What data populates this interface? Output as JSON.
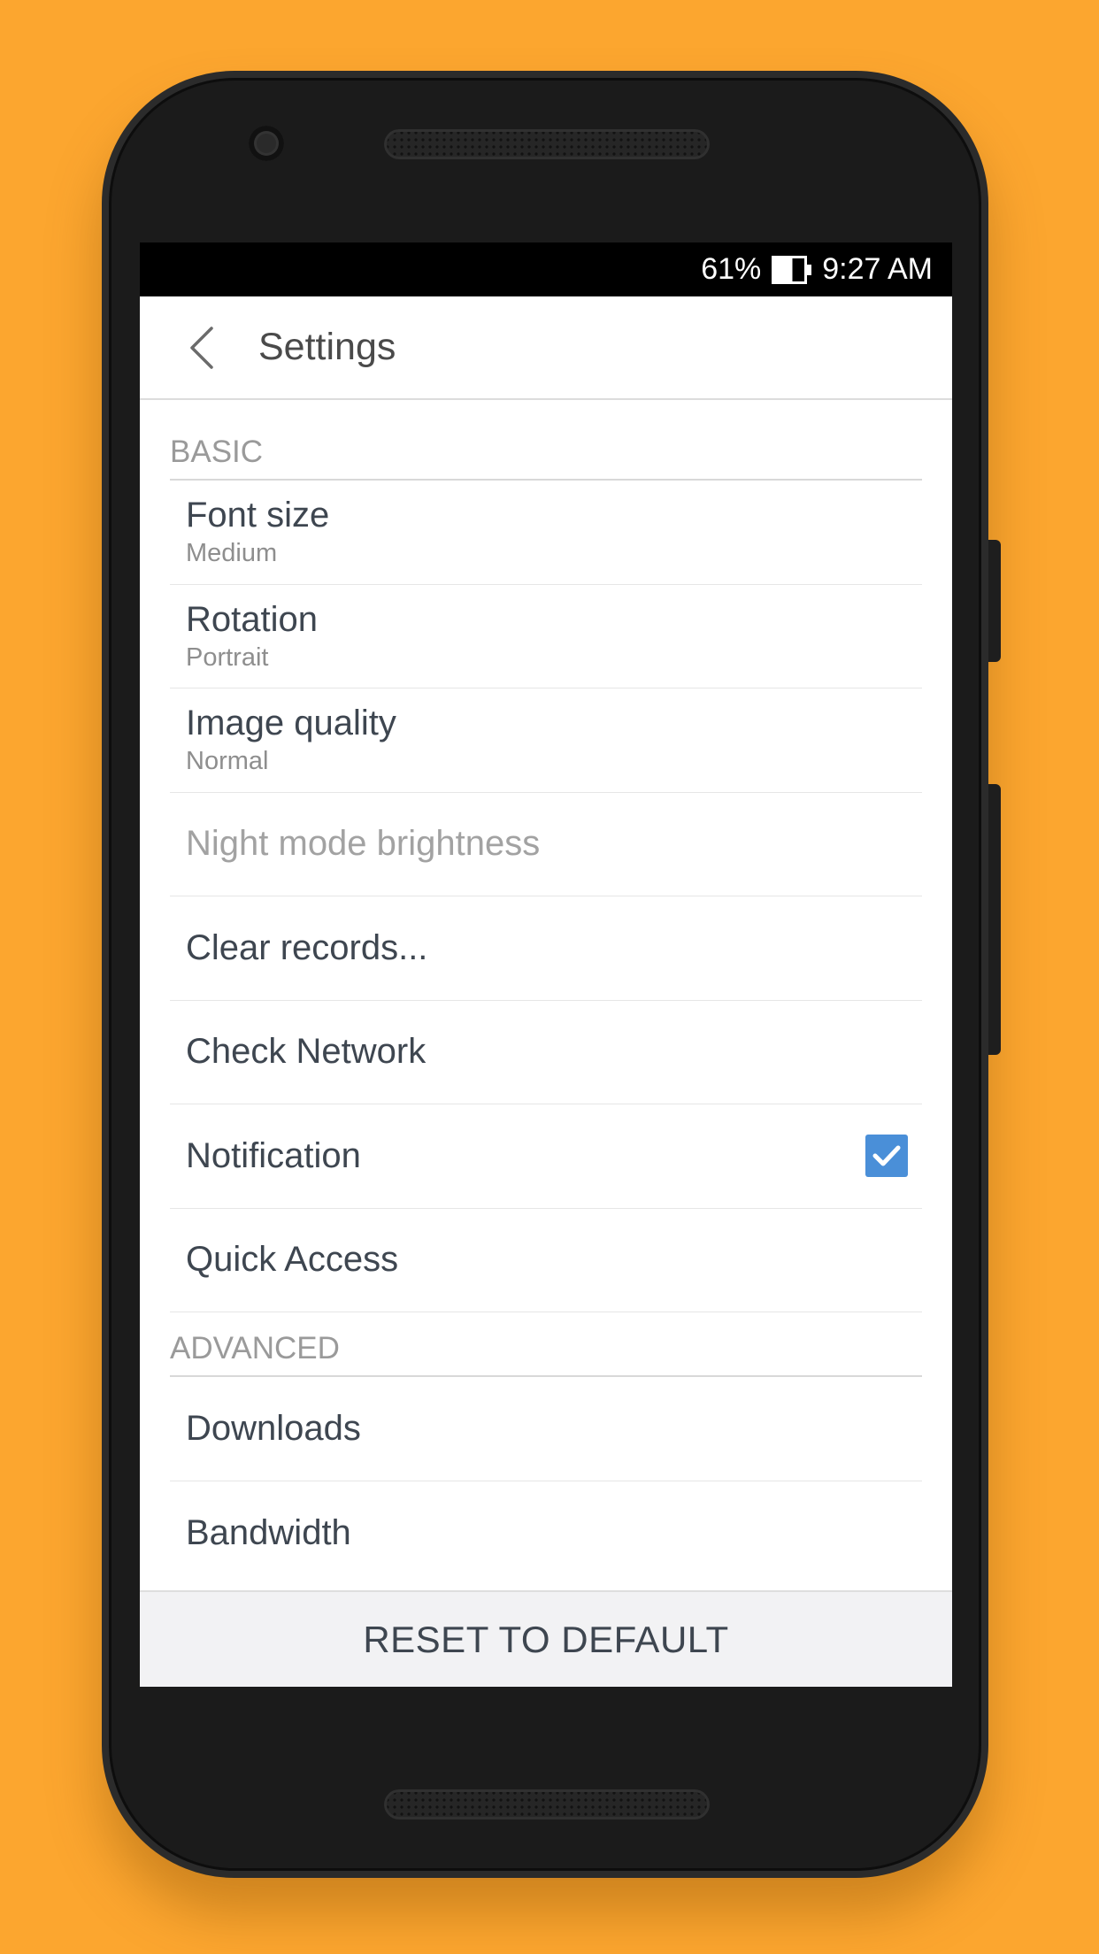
{
  "status_bar": {
    "battery_percent": "61%",
    "battery_level": 0.61,
    "time": "9:27 AM"
  },
  "app_bar": {
    "title": "Settings",
    "back_icon": "chevron-left-icon"
  },
  "sections": {
    "basic": {
      "header": "BASIC",
      "items": [
        {
          "title": "Font size",
          "subtitle": "Medium"
        },
        {
          "title": "Rotation",
          "subtitle": "Portrait"
        },
        {
          "title": "Image quality",
          "subtitle": "Normal"
        },
        {
          "title": "Night mode brightness",
          "enabled": false
        },
        {
          "title": "Clear records..."
        },
        {
          "title": "Check Network"
        },
        {
          "title": "Notification",
          "checked": true
        },
        {
          "title": "Quick Access"
        }
      ]
    },
    "advanced": {
      "header": "ADVANCED",
      "items": [
        {
          "title": "Downloads"
        },
        {
          "title": "Bandwidth"
        }
      ]
    }
  },
  "footer": {
    "reset_label": "RESET TO DEFAULT"
  },
  "colors": {
    "background": "#FCA62F",
    "checkbox": "#4A8FD8",
    "text_primary": "#3E4650",
    "text_secondary": "#8E8E8E"
  }
}
